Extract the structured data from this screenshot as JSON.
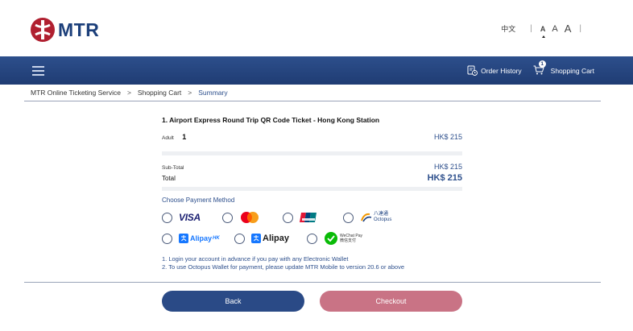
{
  "brand": {
    "name": "MTR",
    "color": "#1c3f7a",
    "accent": "#b02030"
  },
  "header": {
    "language": "中文",
    "font_sizes": [
      "A",
      "A",
      "A"
    ]
  },
  "nav": {
    "menu_icon": "hamburger-icon",
    "order_history": "Order History",
    "shopping_cart": "Shopping Cart",
    "cart_count": "1"
  },
  "breadcrumb": {
    "items": [
      "MTR Online Ticketing Service",
      "Shopping Cart",
      "Summary"
    ]
  },
  "summary": {
    "item_title": "1. Airport Express Round Trip QR Code Ticket - Hong Kong Station",
    "adult_label": "Adult",
    "adult_qty": "1",
    "adult_price": "HK$ 215",
    "subtotal_label": "Sub-Total",
    "subtotal_value": "HK$ 215",
    "total_label": "Total",
    "total_value": "HK$ 215"
  },
  "payment": {
    "title": "Choose Payment Method",
    "methods": {
      "visa": "VISA",
      "mastercard": "mastercard-icon",
      "unionpay": "unionpay-icon",
      "octopus": "Octopus",
      "octopus_cn": "八達通",
      "alipayhk": "Alipay",
      "alipayhk_suffix": "HK",
      "alipay": "Alipay",
      "wechat_line1": "WeChat Pay",
      "wechat_line2": "微信支付"
    }
  },
  "notes": {
    "line1": "1. Login your account in advance if you pay with any Electronic Wallet",
    "line2": "2. To use Octopus Wallet for payment, please update MTR Mobile to version 20.6 or above"
  },
  "actions": {
    "back": "Back",
    "checkout": "Checkout"
  }
}
